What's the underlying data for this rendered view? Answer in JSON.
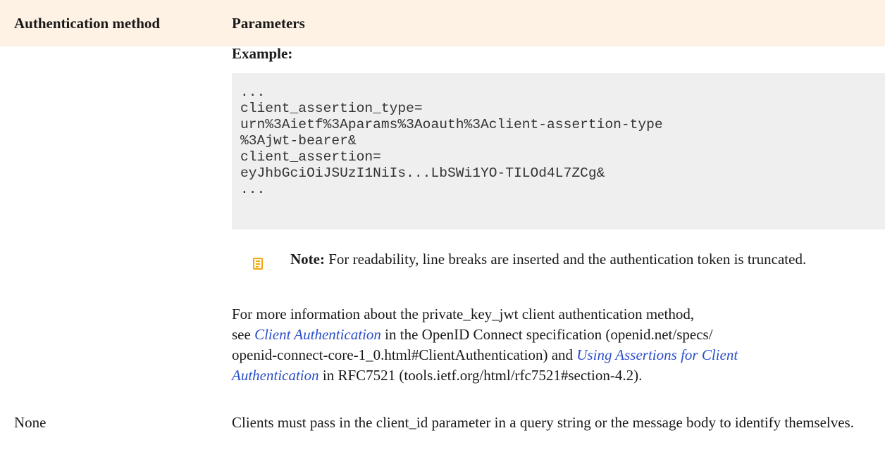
{
  "table": {
    "headers": [
      "Authentication method",
      "Parameters"
    ]
  },
  "example": {
    "label": "Example:",
    "code_lines": [
      "...",
      "client_assertion_type=",
      "urn%3Aietf%3Aparams%3Aoauth%3Aclient-assertion-type",
      "%3Ajwt-bearer&",
      "client_assertion=",
      "eyJhbGciOiJSUzI1NiIs...LbSWi1YO-TILOd4L7ZCg&",
      "..."
    ]
  },
  "note": {
    "label": "Note:",
    "text": " For readability, line breaks are inserted and the authentication token is truncated."
  },
  "more_info": {
    "line1": "For more information about the private_key_jwt client authentication method,",
    "see": "see ",
    "link1": "Client Authentication",
    "text2": " in the OpenID Connect specification (openid.net/specs/",
    "text3": "openid-connect-core-1_0.html#ClientAuthentication) and ",
    "link2a": "Using Assertions for Client",
    "link2b": "Authentication",
    "text4": " in RFC7521 (tools.ietf.org/html/rfc7521#section-4.2)."
  },
  "rows": {
    "none": {
      "method": "None",
      "description": "Clients must pass in the client_id parameter in a query string or the message body to identify themselves."
    }
  },
  "colors": {
    "header_bg": "#fdf2e3",
    "code_bg": "#efefef",
    "link": "#2b4fc9",
    "note_icon": "#f2a713"
  }
}
